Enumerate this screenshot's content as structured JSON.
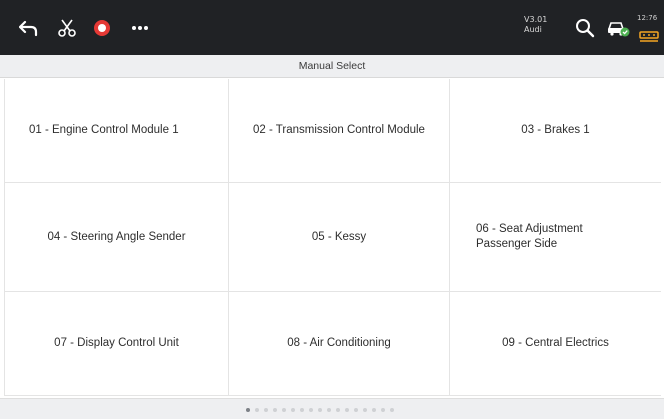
{
  "header": {
    "version": "V3.01",
    "brand": "Audi",
    "time": "12:76",
    "icons": {
      "back": "back-arrow-icon",
      "cut": "scissors-icon",
      "record": "record-icon",
      "more": "more-icon",
      "search": "search-icon",
      "vehicle": "car-check-icon",
      "vci": "vci-connector-icon"
    }
  },
  "page": {
    "title": "Manual Select"
  },
  "modules": [
    {
      "label": "01 - Engine Control Module 1"
    },
    {
      "label": "02 - Transmission Control Module"
    },
    {
      "label": "03 - Brakes 1"
    },
    {
      "label": "04 - Steering Angle Sender"
    },
    {
      "label": "05 - Kessy"
    },
    {
      "label": "06 - Seat Adjustment Passenger Side"
    },
    {
      "label": "07 - Display Control Unit"
    },
    {
      "label": "08 - Air Conditioning"
    },
    {
      "label": "09 - Central Electrics"
    }
  ],
  "pagination": {
    "current": 1,
    "total": 17
  },
  "colors": {
    "topbar": "#202225",
    "record_icon": "#e53935",
    "vehicle_status": "#4caf50",
    "vci_icon": "#f5a623"
  }
}
